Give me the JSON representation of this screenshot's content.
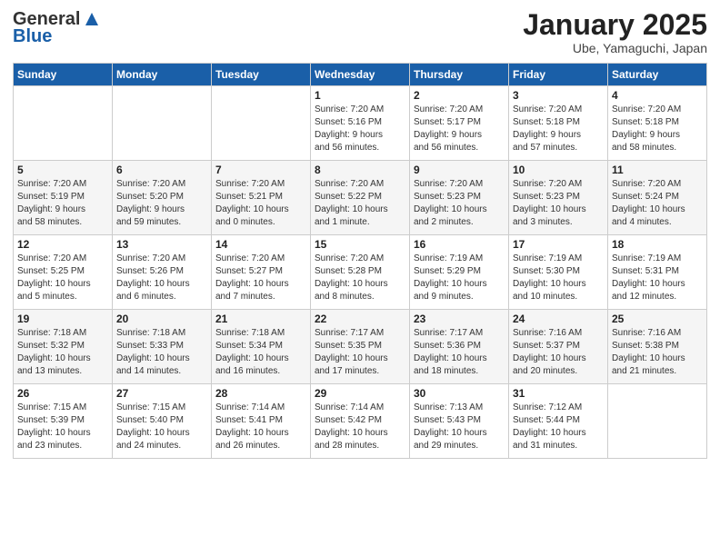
{
  "header": {
    "logo_general": "General",
    "logo_blue": "Blue",
    "title": "January 2025",
    "subtitle": "Ube, Yamaguchi, Japan"
  },
  "days_of_week": [
    "Sunday",
    "Monday",
    "Tuesday",
    "Wednesday",
    "Thursday",
    "Friday",
    "Saturday"
  ],
  "weeks": [
    [
      {
        "day": "",
        "info": ""
      },
      {
        "day": "",
        "info": ""
      },
      {
        "day": "",
        "info": ""
      },
      {
        "day": "1",
        "info": "Sunrise: 7:20 AM\nSunset: 5:16 PM\nDaylight: 9 hours\nand 56 minutes."
      },
      {
        "day": "2",
        "info": "Sunrise: 7:20 AM\nSunset: 5:17 PM\nDaylight: 9 hours\nand 56 minutes."
      },
      {
        "day": "3",
        "info": "Sunrise: 7:20 AM\nSunset: 5:18 PM\nDaylight: 9 hours\nand 57 minutes."
      },
      {
        "day": "4",
        "info": "Sunrise: 7:20 AM\nSunset: 5:18 PM\nDaylight: 9 hours\nand 58 minutes."
      }
    ],
    [
      {
        "day": "5",
        "info": "Sunrise: 7:20 AM\nSunset: 5:19 PM\nDaylight: 9 hours\nand 58 minutes."
      },
      {
        "day": "6",
        "info": "Sunrise: 7:20 AM\nSunset: 5:20 PM\nDaylight: 9 hours\nand 59 minutes."
      },
      {
        "day": "7",
        "info": "Sunrise: 7:20 AM\nSunset: 5:21 PM\nDaylight: 10 hours\nand 0 minutes."
      },
      {
        "day": "8",
        "info": "Sunrise: 7:20 AM\nSunset: 5:22 PM\nDaylight: 10 hours\nand 1 minute."
      },
      {
        "day": "9",
        "info": "Sunrise: 7:20 AM\nSunset: 5:23 PM\nDaylight: 10 hours\nand 2 minutes."
      },
      {
        "day": "10",
        "info": "Sunrise: 7:20 AM\nSunset: 5:23 PM\nDaylight: 10 hours\nand 3 minutes."
      },
      {
        "day": "11",
        "info": "Sunrise: 7:20 AM\nSunset: 5:24 PM\nDaylight: 10 hours\nand 4 minutes."
      }
    ],
    [
      {
        "day": "12",
        "info": "Sunrise: 7:20 AM\nSunset: 5:25 PM\nDaylight: 10 hours\nand 5 minutes."
      },
      {
        "day": "13",
        "info": "Sunrise: 7:20 AM\nSunset: 5:26 PM\nDaylight: 10 hours\nand 6 minutes."
      },
      {
        "day": "14",
        "info": "Sunrise: 7:20 AM\nSunset: 5:27 PM\nDaylight: 10 hours\nand 7 minutes."
      },
      {
        "day": "15",
        "info": "Sunrise: 7:20 AM\nSunset: 5:28 PM\nDaylight: 10 hours\nand 8 minutes."
      },
      {
        "day": "16",
        "info": "Sunrise: 7:19 AM\nSunset: 5:29 PM\nDaylight: 10 hours\nand 9 minutes."
      },
      {
        "day": "17",
        "info": "Sunrise: 7:19 AM\nSunset: 5:30 PM\nDaylight: 10 hours\nand 10 minutes."
      },
      {
        "day": "18",
        "info": "Sunrise: 7:19 AM\nSunset: 5:31 PM\nDaylight: 10 hours\nand 12 minutes."
      }
    ],
    [
      {
        "day": "19",
        "info": "Sunrise: 7:18 AM\nSunset: 5:32 PM\nDaylight: 10 hours\nand 13 minutes."
      },
      {
        "day": "20",
        "info": "Sunrise: 7:18 AM\nSunset: 5:33 PM\nDaylight: 10 hours\nand 14 minutes."
      },
      {
        "day": "21",
        "info": "Sunrise: 7:18 AM\nSunset: 5:34 PM\nDaylight: 10 hours\nand 16 minutes."
      },
      {
        "day": "22",
        "info": "Sunrise: 7:17 AM\nSunset: 5:35 PM\nDaylight: 10 hours\nand 17 minutes."
      },
      {
        "day": "23",
        "info": "Sunrise: 7:17 AM\nSunset: 5:36 PM\nDaylight: 10 hours\nand 18 minutes."
      },
      {
        "day": "24",
        "info": "Sunrise: 7:16 AM\nSunset: 5:37 PM\nDaylight: 10 hours\nand 20 minutes."
      },
      {
        "day": "25",
        "info": "Sunrise: 7:16 AM\nSunset: 5:38 PM\nDaylight: 10 hours\nand 21 minutes."
      }
    ],
    [
      {
        "day": "26",
        "info": "Sunrise: 7:15 AM\nSunset: 5:39 PM\nDaylight: 10 hours\nand 23 minutes."
      },
      {
        "day": "27",
        "info": "Sunrise: 7:15 AM\nSunset: 5:40 PM\nDaylight: 10 hours\nand 24 minutes."
      },
      {
        "day": "28",
        "info": "Sunrise: 7:14 AM\nSunset: 5:41 PM\nDaylight: 10 hours\nand 26 minutes."
      },
      {
        "day": "29",
        "info": "Sunrise: 7:14 AM\nSunset: 5:42 PM\nDaylight: 10 hours\nand 28 minutes."
      },
      {
        "day": "30",
        "info": "Sunrise: 7:13 AM\nSunset: 5:43 PM\nDaylight: 10 hours\nand 29 minutes."
      },
      {
        "day": "31",
        "info": "Sunrise: 7:12 AM\nSunset: 5:44 PM\nDaylight: 10 hours\nand 31 minutes."
      },
      {
        "day": "",
        "info": ""
      }
    ]
  ]
}
